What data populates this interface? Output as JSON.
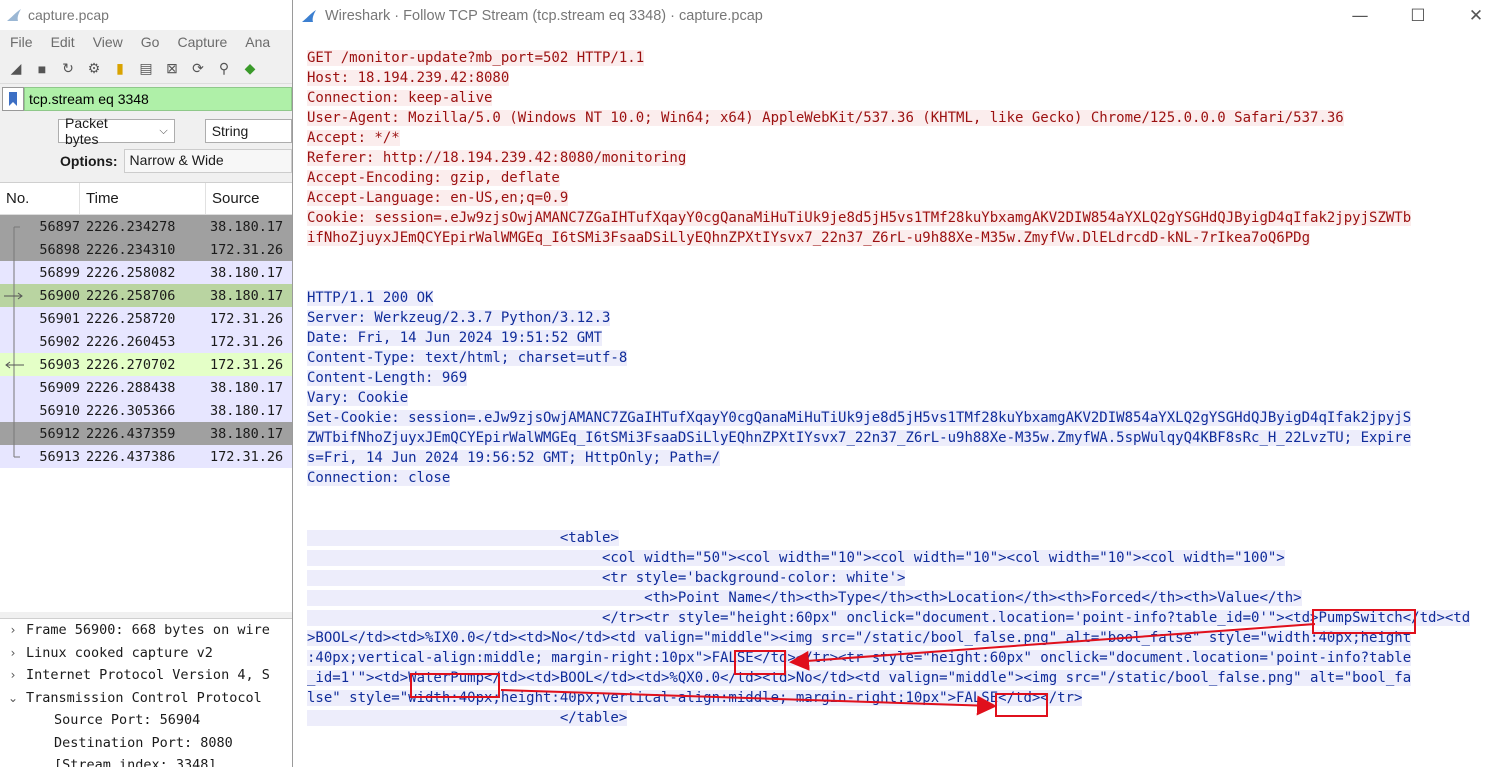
{
  "main_window": {
    "title": "capture.pcap",
    "menu": [
      "File",
      "Edit",
      "View",
      "Go",
      "Capture",
      "Ana"
    ],
    "filter_value": "tcp.stream eq 3348",
    "format_select": "Packet bytes",
    "string_select": "String",
    "options_label": "Options:",
    "options_value": "Narrow & Wide",
    "columns": [
      "No.",
      "Time",
      "Source"
    ],
    "packets": [
      {
        "no": "56897",
        "time": "2226.234278",
        "src": "38.180.17",
        "bg": "#a0a0a0"
      },
      {
        "no": "56898",
        "time": "2226.234310",
        "src": "172.31.26",
        "bg": "#a0a0a0"
      },
      {
        "no": "56899",
        "time": "2226.258082",
        "src": "38.180.17",
        "bg": "#e7e6ff"
      },
      {
        "no": "56900",
        "time": "2226.258706",
        "src": "38.180.17",
        "bg": "#b9d4a1"
      },
      {
        "no": "56901",
        "time": "2226.258720",
        "src": "172.31.26",
        "bg": "#e7e6ff"
      },
      {
        "no": "56902",
        "time": "2226.260453",
        "src": "172.31.26",
        "bg": "#e7e6ff"
      },
      {
        "no": "56903",
        "time": "2226.270702",
        "src": "172.31.26",
        "bg": "#e4ffc7"
      },
      {
        "no": "56909",
        "time": "2226.288438",
        "src": "38.180.17",
        "bg": "#e7e6ff"
      },
      {
        "no": "56910",
        "time": "2226.305366",
        "src": "38.180.17",
        "bg": "#e7e6ff"
      },
      {
        "no": "56912",
        "time": "2226.437359",
        "src": "38.180.17",
        "bg": "#a0a0a0"
      },
      {
        "no": "56913",
        "time": "2226.437386",
        "src": "172.31.26",
        "bg": "#e7e6ff"
      }
    ],
    "details": [
      {
        "arrow": "›",
        "text": "Frame 56900: 668 bytes on wire",
        "child": false
      },
      {
        "arrow": "›",
        "text": "Linux cooked capture v2",
        "child": false
      },
      {
        "arrow": "›",
        "text": "Internet Protocol Version 4, S",
        "child": false
      },
      {
        "arrow": "⌄",
        "text": "Transmission Control Protocol",
        "child": false
      },
      {
        "arrow": "",
        "text": "Source Port: 56904",
        "child": true
      },
      {
        "arrow": "",
        "text": "Destination Port: 8080",
        "child": true
      },
      {
        "arrow": "",
        "text": "[Stream index: 3348]",
        "child": true
      }
    ]
  },
  "dialog": {
    "title": "Wireshark · Follow TCP Stream (tcp.stream eq 3348) · capture.pcap",
    "lines": [
      {
        "kind": "req",
        "text": "GET /monitor-update?mb_port=502 HTTP/1.1"
      },
      {
        "kind": "req",
        "text": "Host: 18.194.239.42:8080"
      },
      {
        "kind": "req",
        "text": "Connection: keep-alive"
      },
      {
        "kind": "req",
        "text": "User-Agent: Mozilla/5.0 (Windows NT 10.0; Win64; x64) AppleWebKit/537.36 (KHTML, like Gecko) Chrome/125.0.0.0 Safari/537.36"
      },
      {
        "kind": "req",
        "text": "Accept: */*"
      },
      {
        "kind": "req",
        "text": "Referer: http://18.194.239.42:8080/monitoring"
      },
      {
        "kind": "req",
        "text": "Accept-Encoding: gzip, deflate"
      },
      {
        "kind": "req",
        "text": "Accept-Language: en-US,en;q=0.9"
      },
      {
        "kind": "req",
        "text": "Cookie: session=.eJw9zjsOwjAMANC7ZGaIHTufXqayY0cgQanaMiHuTiUk9je8d5jH5vs1TMf28kuYbxamgAKV2DIW854aYXLQ2gYSGHdQJByigD4qIfak2jpyjSZWTb"
      },
      {
        "kind": "req",
        "text": "ifNhoZjuyxJEmQCYEpirWalWMGEq_I6tSMi3FsaaDSiLlyEQhnZPXtIYsvx7_22n37_Z6rL-u9h88Xe-M35w.ZmyfVw.DlELdrcdD-kNL-7rIkea7oQ6PDg"
      },
      {
        "kind": "blank",
        "text": ""
      },
      {
        "kind": "blank",
        "text": ""
      },
      {
        "kind": "resp",
        "text": "HTTP/1.1 200 OK"
      },
      {
        "kind": "resp",
        "text": "Server: Werkzeug/2.3.7 Python/3.12.3"
      },
      {
        "kind": "resp",
        "text": "Date: Fri, 14 Jun 2024 19:51:52 GMT"
      },
      {
        "kind": "resp",
        "text": "Content-Type: text/html; charset=utf-8"
      },
      {
        "kind": "resp",
        "text": "Content-Length: 969"
      },
      {
        "kind": "resp",
        "text": "Vary: Cookie"
      },
      {
        "kind": "resp",
        "text": "Set-Cookie: session=.eJw9zjsOwjAMANC7ZGaIHTufXqayY0cgQanaMiHuTiUk9je8d5jH5vs1TMf28kuYbxamgAKV2DIW854aYXLQ2gYSGHdQJByigD4qIfak2jpyjS"
      },
      {
        "kind": "resp",
        "text": "ZWTbifNhoZjuyxJEmQCYEpirWalWMGEq_I6tSMi3FsaaDSiLlyEQhnZPXtIYsvx7_22n37_Z6rL-u9h88Xe-M35w.ZmyfWA.5spWulqyQ4KBF8sRc_H_22LvzTU; Expire"
      },
      {
        "kind": "resp",
        "text": "s=Fri, 14 Jun 2024 19:56:52 GMT; HttpOnly; Path=/"
      },
      {
        "kind": "resp",
        "text": "Connection: close"
      },
      {
        "kind": "blank",
        "text": ""
      },
      {
        "kind": "blank",
        "text": ""
      },
      {
        "kind": "resp",
        "text": "                              <table>"
      },
      {
        "kind": "resp",
        "text": "                                   <col width=\"50\"><col width=\"10\"><col width=\"10\"><col width=\"10\"><col width=\"100\">"
      },
      {
        "kind": "resp",
        "text": "                                   <tr style='background-color: white'>"
      },
      {
        "kind": "resp",
        "text": "                                        <th>Point Name</th><th>Type</th><th>Location</th><th>Forced</th><th>Value</th>"
      },
      {
        "kind": "resp",
        "text": "                                   </tr><tr style=\"height:60px\" onclick=\"document.location='point-info?table_id=0'\"><td>PumpSwitch</td><td"
      },
      {
        "kind": "resp",
        "text": ">BOOL</td><td>%IX0.0</td><td>No</td><td valign=\"middle\"><img src=\"/static/bool_false.png\" alt=\"bool_false\" style=\"width:40px;height"
      },
      {
        "kind": "resp",
        "text": ":40px;vertical-align:middle; margin-right:10px\">FALSE</td></tr><tr style=\"height:60px\" onclick=\"document.location='point-info?table"
      },
      {
        "kind": "resp",
        "text": "_id=1'\"><td>WaterPump</td><td>BOOL</td><td>%QX0.0</td><td>No</td><td valign=\"middle\"><img src=\"/static/bool_false.png\" alt=\"bool_fa"
      },
      {
        "kind": "resp",
        "text": "lse\" style=\"width:40px;height:40px;vertical-align:middle; margin-right:10px\">FALSE</td></tr>"
      },
      {
        "kind": "resp",
        "text": "                              </table>"
      }
    ]
  },
  "annotation_color": "#e0101c"
}
